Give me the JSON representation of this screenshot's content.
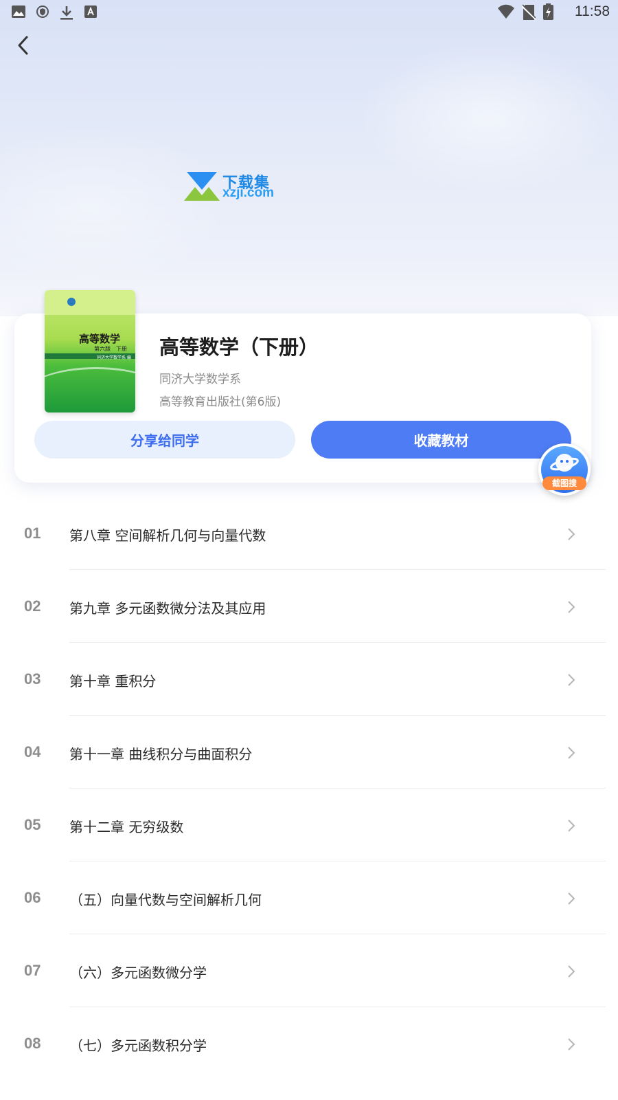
{
  "status_bar": {
    "time": "11:58",
    "left_icons": [
      "image-icon",
      "shield-icon",
      "download-icon",
      "text-icon"
    ],
    "right_icons": [
      "wifi-icon",
      "no-sim-icon",
      "battery-charging-icon"
    ]
  },
  "watermark": {
    "name_cn": "下载集",
    "name_en": "xzji.com"
  },
  "book": {
    "cover": {
      "title": "高等数学",
      "edition_line": "第六版　下册",
      "author_line": "同济大学数学系 编"
    },
    "title": "高等数学（下册）",
    "author": "同济大学数学系",
    "publisher": "高等教育出版社(第6版)"
  },
  "actions": {
    "share_label": "分享给同学",
    "collect_label": "收藏教材"
  },
  "fab": {
    "label": "截图搜"
  },
  "toc": {
    "items": [
      {
        "num": "01",
        "title": "第八章 空间解析几何与向量代数"
      },
      {
        "num": "02",
        "title": "第九章 多元函数微分法及其应用"
      },
      {
        "num": "03",
        "title": "第十章 重积分"
      },
      {
        "num": "04",
        "title": "第十一章 曲线积分与曲面积分"
      },
      {
        "num": "05",
        "title": "第十二章 无穷级数"
      },
      {
        "num": "06",
        "title": "（五）向量代数与空间解析几何"
      },
      {
        "num": "07",
        "title": "（六）多元函数微分学"
      },
      {
        "num": "08",
        "title": "（七）多元函数积分学"
      }
    ]
  },
  "colors": {
    "accent": "#4d7cf5",
    "share_bg": "#e8effd",
    "share_text": "#3c6df0",
    "fab_badge": "#ff8a3d"
  }
}
